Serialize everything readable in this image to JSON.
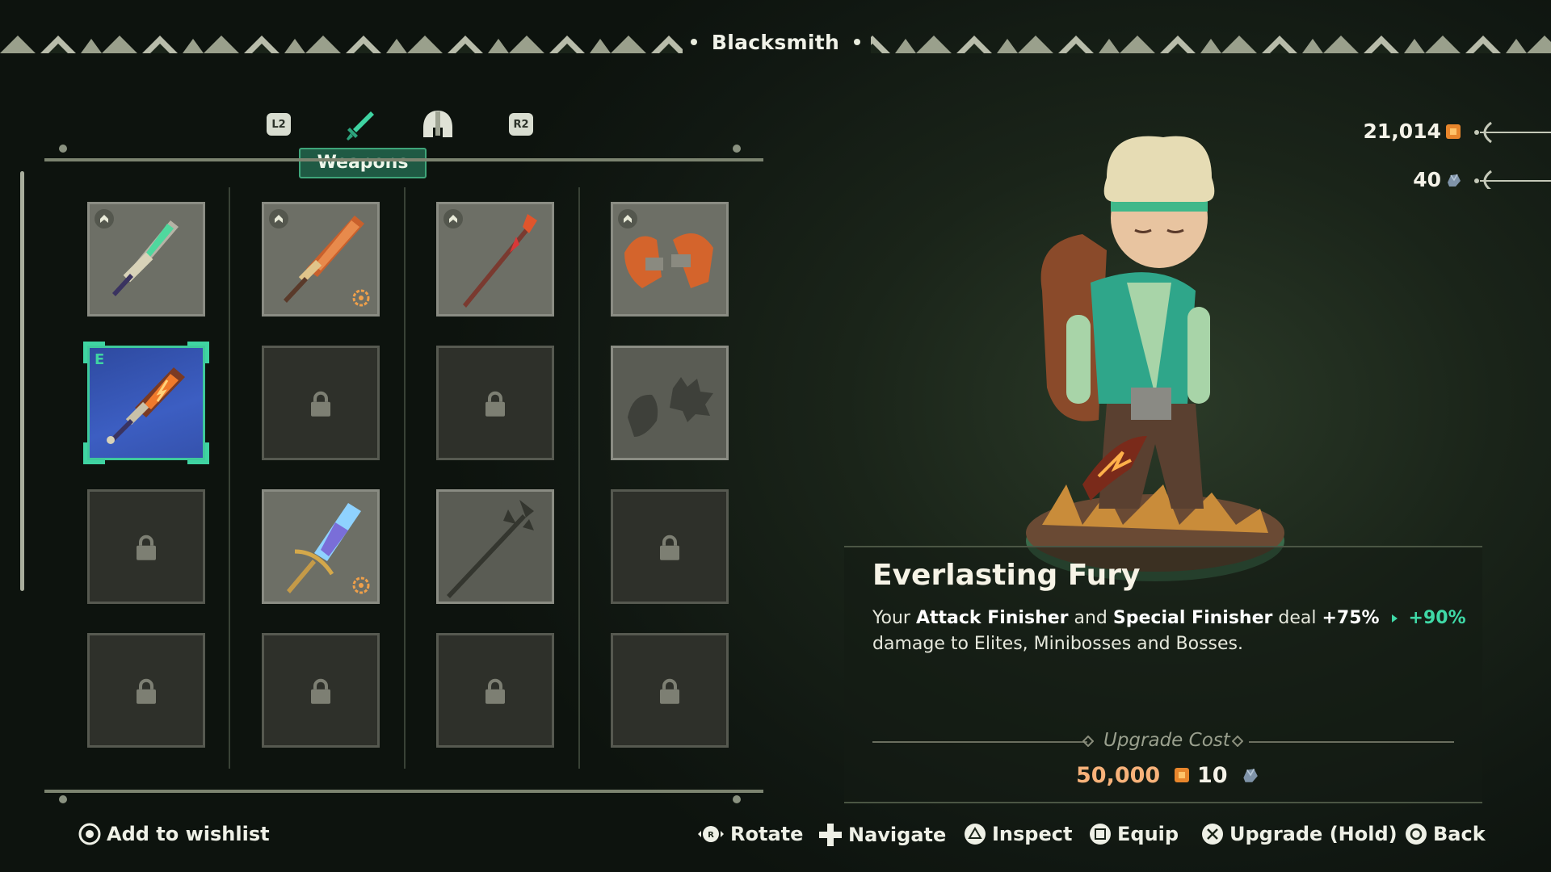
{
  "header": {
    "title": "Blacksmith"
  },
  "tabs": {
    "left_shoulder": "L2",
    "right_shoulder": "R2",
    "active_label": "Weapons",
    "icons": [
      "sword-icon",
      "helmet-icon"
    ]
  },
  "currency": {
    "gold": "21,014",
    "ore": "40"
  },
  "grid": {
    "cells": [
      {
        "state": "unlocked",
        "icon": "green-sword-icon",
        "badge": true,
        "upgrade": false
      },
      {
        "state": "unlocked",
        "icon": "orange-greatsword-icon",
        "badge": true,
        "upgrade": true
      },
      {
        "state": "unlocked",
        "icon": "red-spear-icon",
        "badge": true,
        "upgrade": false
      },
      {
        "state": "unlocked",
        "icon": "gauntlets-icon",
        "badge": true,
        "upgrade": false
      },
      {
        "state": "selected",
        "icon": "fire-sword-icon",
        "equipped_tag": "E"
      },
      {
        "state": "locked"
      },
      {
        "state": "locked"
      },
      {
        "state": "silhouette",
        "icon": "mystery-weapon-icon"
      },
      {
        "state": "locked"
      },
      {
        "state": "unlocked",
        "icon": "crystal-bow-icon",
        "upgrade": true
      },
      {
        "state": "silhouette",
        "icon": "trident-silhouette-icon"
      },
      {
        "state": "locked"
      },
      {
        "state": "locked"
      },
      {
        "state": "locked"
      },
      {
        "state": "locked"
      },
      {
        "state": "locked"
      }
    ]
  },
  "item": {
    "name": "Everlasting Fury",
    "desc_1": "Your ",
    "desc_bold_1": "Attack Finisher",
    "desc_2": " and ",
    "desc_bold_2": "Special Finisher",
    "desc_3": " deal ",
    "desc_current": "+75%",
    "desc_next": "+90%",
    "desc_line2": "damage to Elites, Minibosses and Bosses."
  },
  "upgrade_cost": {
    "label": "Upgrade Cost",
    "gold": "50,000",
    "ore": "10"
  },
  "hints": {
    "wishlist": "Add to wishlist",
    "rotate": "Rotate",
    "navigate": "Navigate",
    "inspect": "Inspect",
    "equip": "Equip",
    "upgrade": "Upgrade (Hold)",
    "back": "Back"
  },
  "colors": {
    "accent": "#3fd8a6",
    "gold_text": "#f7b27a",
    "selected_bg": "#3c5ec2"
  }
}
